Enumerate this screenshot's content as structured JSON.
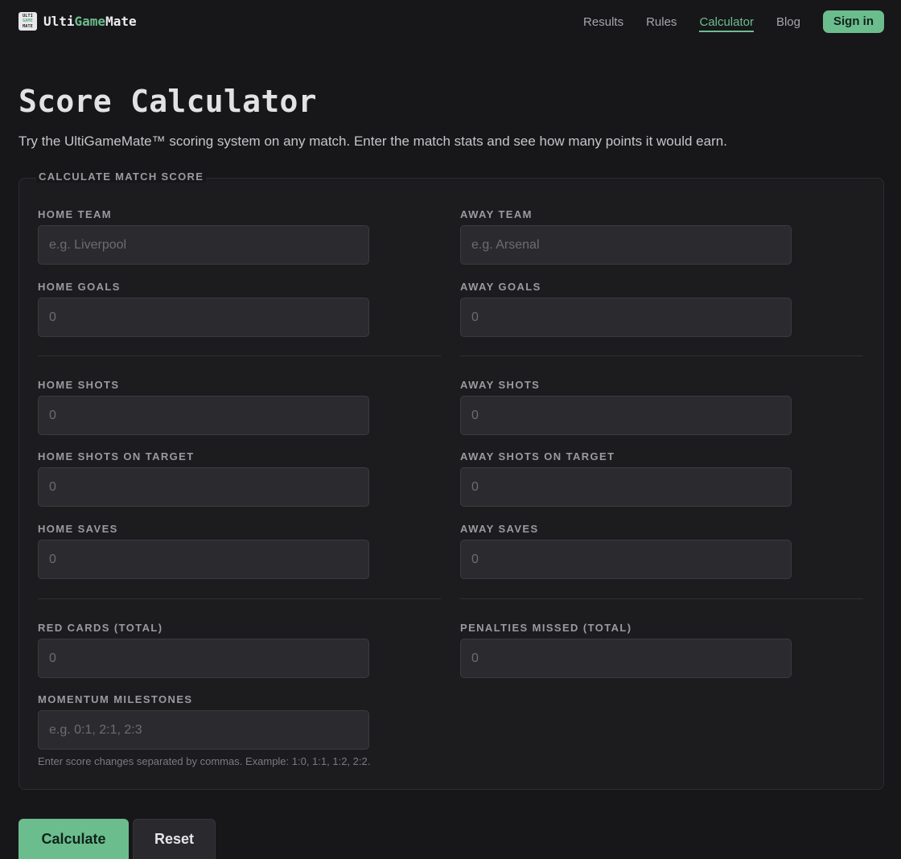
{
  "brand": {
    "logo_lines": [
      "ULTI",
      "GAME",
      "MATE"
    ],
    "name_part1": "Ulti",
    "name_part2": "Game",
    "name_part3": "Mate"
  },
  "nav": {
    "items": [
      {
        "label": "Results",
        "active": false
      },
      {
        "label": "Rules",
        "active": false
      },
      {
        "label": "Calculator",
        "active": true
      },
      {
        "label": "Blog",
        "active": false
      }
    ],
    "signin_label": "Sign in"
  },
  "page": {
    "title": "Score Calculator",
    "subtitle": "Try the UltiGameMate™ scoring system on any match. Enter the match stats and see how many points it would earn."
  },
  "form": {
    "legend": "CALCULATE MATCH SCORE",
    "fields": {
      "home_team": {
        "label": "HOME TEAM",
        "placeholder": "e.g. Liverpool",
        "value": ""
      },
      "away_team": {
        "label": "AWAY TEAM",
        "placeholder": "e.g. Arsenal",
        "value": ""
      },
      "home_goals": {
        "label": "HOME GOALS",
        "placeholder": "0",
        "value": ""
      },
      "away_goals": {
        "label": "AWAY GOALS",
        "placeholder": "0",
        "value": ""
      },
      "home_shots": {
        "label": "HOME SHOTS",
        "placeholder": "0",
        "value": ""
      },
      "away_shots": {
        "label": "AWAY SHOTS",
        "placeholder": "0",
        "value": ""
      },
      "home_shots_on_target": {
        "label": "HOME SHOTS ON TARGET",
        "placeholder": "0",
        "value": ""
      },
      "away_shots_on_target": {
        "label": "AWAY SHOTS ON TARGET",
        "placeholder": "0",
        "value": ""
      },
      "home_saves": {
        "label": "HOME SAVES",
        "placeholder": "0",
        "value": ""
      },
      "away_saves": {
        "label": "AWAY SAVES",
        "placeholder": "0",
        "value": ""
      },
      "red_cards": {
        "label": "RED CARDS (TOTAL)",
        "placeholder": "0",
        "value": ""
      },
      "penalties_missed": {
        "label": "PENALTIES MISSED (TOTAL)",
        "placeholder": "0",
        "value": ""
      },
      "momentum_milestones": {
        "label": "MOMENTUM MILESTONES",
        "placeholder": "e.g. 0:1, 2:1, 2:3",
        "value": ""
      }
    },
    "momentum_hint": "Enter score changes separated by commas. Example: 1:0, 1:1, 1:2, 2:2.",
    "calculate_label": "Calculate",
    "reset_label": "Reset"
  },
  "colors": {
    "accent": "#6cbd8e",
    "background": "#17171a",
    "input_bg": "#2b2b2f"
  }
}
